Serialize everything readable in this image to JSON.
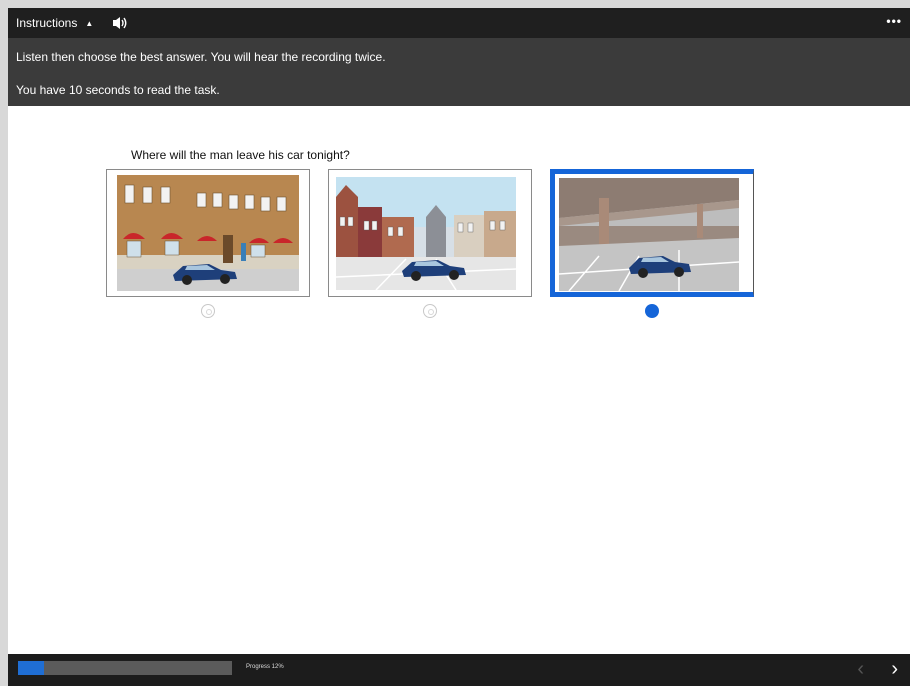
{
  "header": {
    "instructions_label": "Instructions",
    "caret_icon": "caret-up-icon",
    "speaker_icon": "speaker-icon",
    "more_label": "•••"
  },
  "instructions": {
    "line1": "Listen then choose the best answer. You will hear the recording twice.",
    "line2": "You have 10 seconds to read the task."
  },
  "question": {
    "text": "Where will the man leave his car tonight?",
    "options": [
      {
        "scene": "car-parked-on-street-image",
        "selected": false
      },
      {
        "scene": "car-in-town-square-image",
        "selected": false
      },
      {
        "scene": "car-in-parking-garage-image",
        "selected": true
      }
    ]
  },
  "footer": {
    "progress_text": "Progress 12%",
    "progress_value": 0.12,
    "prev_label": "‹",
    "next_label": "›"
  },
  "colors": {
    "accent": "#1565d8",
    "topbar": "#1f1f1f",
    "instructions_bg": "#3b3b3b",
    "footer_bg": "#1c1c1c"
  }
}
